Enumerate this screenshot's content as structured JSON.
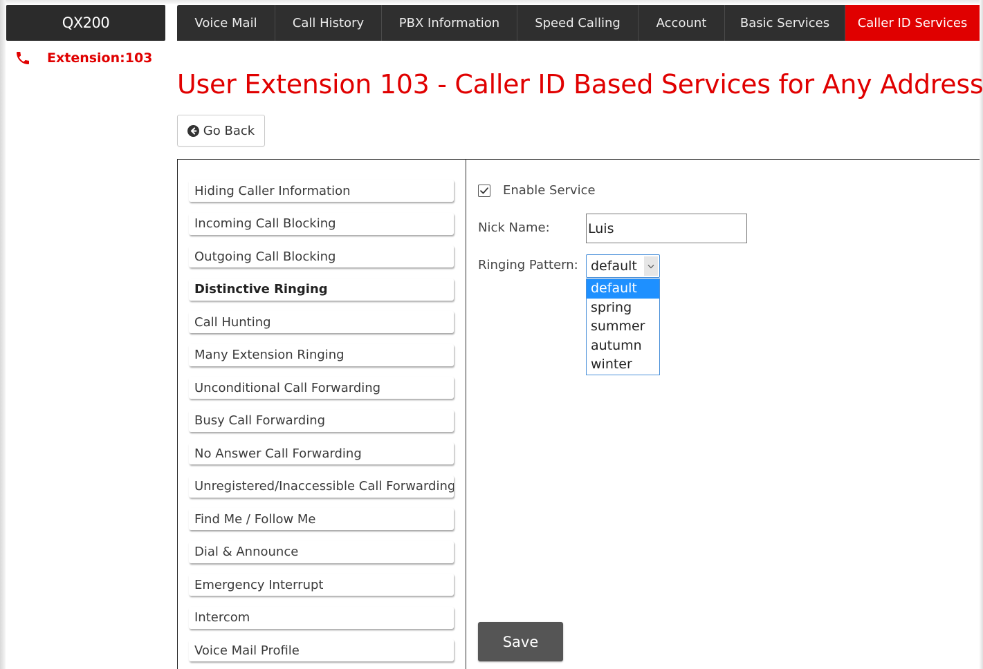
{
  "brand": "QX200",
  "nav": {
    "tabs": [
      {
        "label": "Voice Mail"
      },
      {
        "label": "Call History"
      },
      {
        "label": "PBX Information"
      },
      {
        "label": "Speed Calling"
      },
      {
        "label": "Account"
      },
      {
        "label": "Basic Services"
      },
      {
        "label": "Caller ID Services",
        "active": true
      }
    ]
  },
  "extension": {
    "label": "Extension:103",
    "icon": "phone-icon",
    "color": "#e00000"
  },
  "page_title": "User Extension 103 - Caller ID Based Services for Any Address",
  "go_back": {
    "label": "Go Back",
    "icon": "arrow-circle-left-icon"
  },
  "services": [
    {
      "label": "Hiding Caller Information"
    },
    {
      "label": "Incoming Call Blocking"
    },
    {
      "label": "Outgoing Call Blocking"
    },
    {
      "label": "Distinctive Ringing",
      "selected": true
    },
    {
      "label": "Call Hunting"
    },
    {
      "label": "Many Extension Ringing"
    },
    {
      "label": "Unconditional Call Forwarding"
    },
    {
      "label": "Busy Call Forwarding"
    },
    {
      "label": "No Answer Call Forwarding"
    },
    {
      "label": "Unregistered/Inaccessible Call Forwarding"
    },
    {
      "label": "Find Me / Follow Me"
    },
    {
      "label": "Dial & Announce"
    },
    {
      "label": "Emergency Interrupt"
    },
    {
      "label": "Intercom"
    },
    {
      "label": "Voice Mail Profile"
    }
  ],
  "form": {
    "enable_service": {
      "label": "Enable Service",
      "checked": true
    },
    "nick_name": {
      "label": "Nick Name:",
      "value": "Luis"
    },
    "ringing_pattern": {
      "label": "Ringing Pattern:",
      "selected": "default",
      "options": [
        "default",
        "spring",
        "summer",
        "autumn",
        "winter"
      ]
    },
    "save_label": "Save"
  },
  "colors": {
    "accent": "#e00000",
    "dark_nav": "#2f2f2f",
    "option_highlight": "#1e90ff",
    "save_button": "#555555"
  }
}
